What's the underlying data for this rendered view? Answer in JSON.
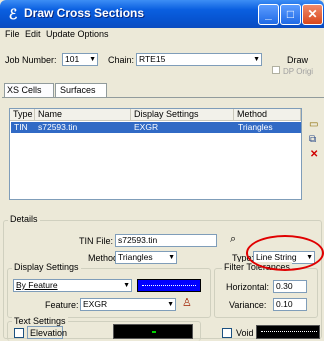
{
  "window": {
    "title": "Draw Cross Sections"
  },
  "menu": {
    "items": [
      "File",
      "Edit",
      "Update Options"
    ]
  },
  "job": {
    "job_number_label": "Job Number:",
    "job_number_value": "101",
    "chain_label": "Chain:",
    "chain_value": "RTE15",
    "draw_button": "Draw",
    "dp_orig_label": "DP Origi"
  },
  "tabs": [
    "XS Cells",
    "Surfaces"
  ],
  "table": {
    "columns": [
      "Type",
      "Name",
      "Display Settings",
      "Method"
    ],
    "rows": [
      {
        "type": "TIN",
        "name": "s72593.tin",
        "display": "EXGR",
        "method": "Triangles"
      }
    ]
  },
  "details": {
    "legend": "Details",
    "tin_file_label": "TIN File:",
    "tin_file_value": "s72593.tin",
    "method_label": "Method:",
    "method_value": "Triangles",
    "type_label": "Type:",
    "type_value": "Line String"
  },
  "display_settings": {
    "legend": "Display Settings",
    "by_feature": "By Feature",
    "feature_label": "Feature:",
    "feature_value": "EXGR"
  },
  "filter_tolerances": {
    "legend": "Filter Tolerances",
    "horizontal_label": "Horizontal:",
    "horizontal_value": "0.30",
    "variance_label": "Variance:",
    "variance_value": "0.10"
  },
  "text_settings": {
    "legend": "Text Settings",
    "elevation_label": "Elevation"
  },
  "void": {
    "label": "Void"
  },
  "colors": {
    "title_bar": "#0754d1",
    "selection": "#316ac5",
    "swatch": "#0000ff",
    "annotation": "#e00000"
  }
}
